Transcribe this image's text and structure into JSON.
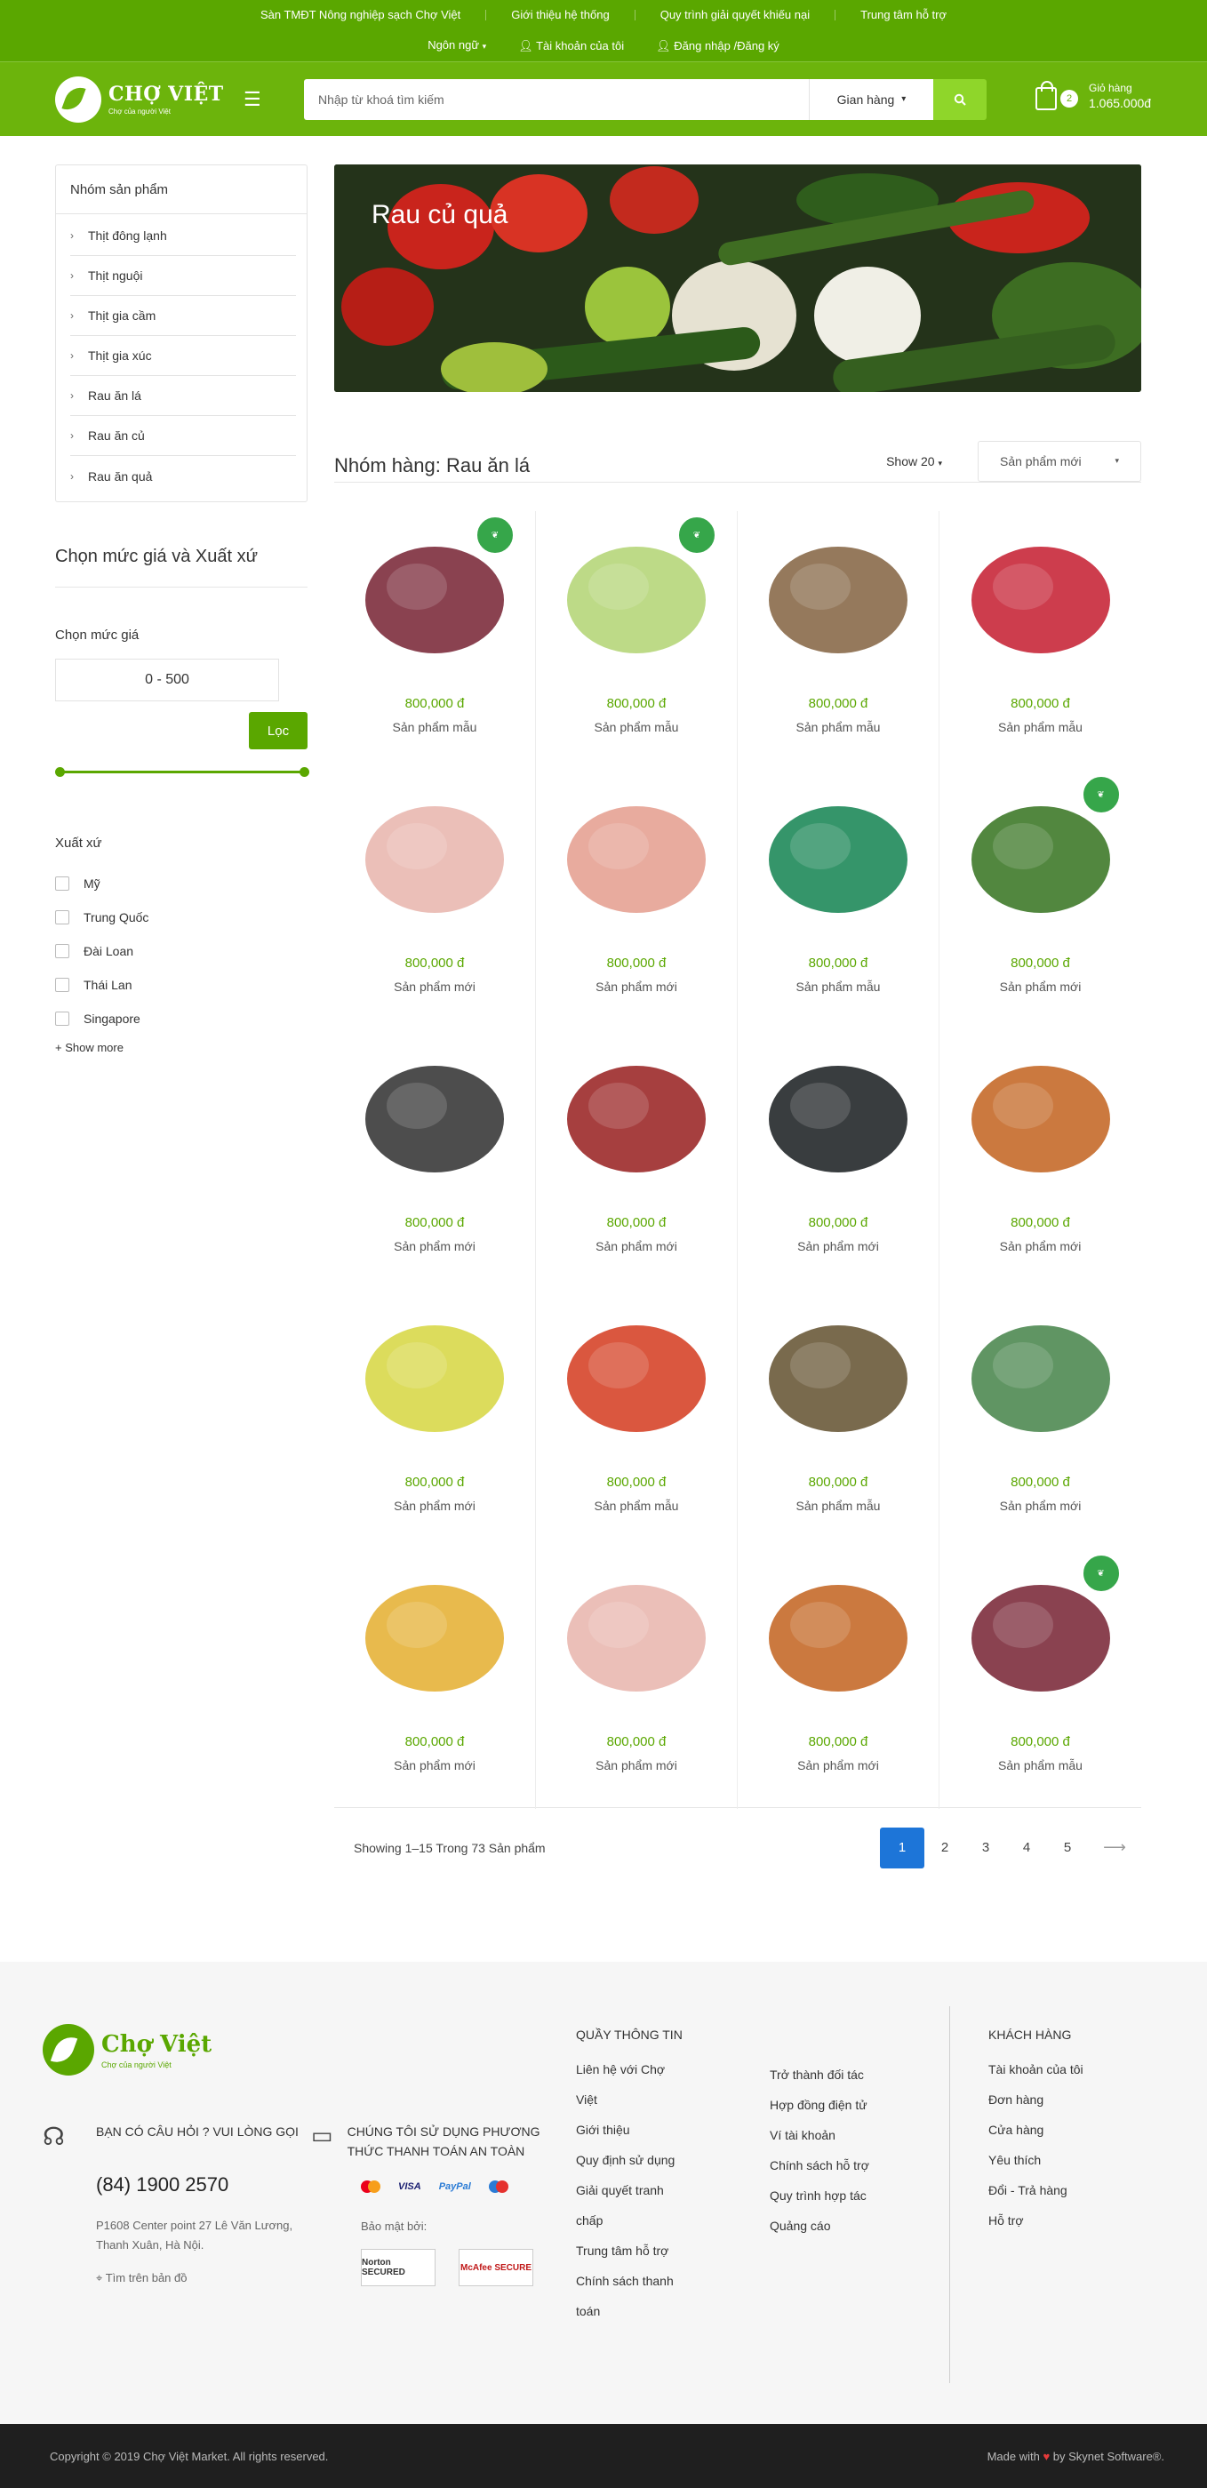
{
  "topbar": {
    "links": [
      "Sàn TMĐT Nông nghiệp sạch Chợ Việt",
      "Giới thiệu hệ thống",
      "Quy trình giải quyết khiếu nại",
      "Trung tâm hỗ trợ"
    ],
    "language": "Ngôn ngữ",
    "account": "Tài khoản của tôi",
    "login": "Đăng nhập /Đăng ký"
  },
  "header": {
    "logo_name": "CHỢ VIỆT",
    "logo_tagline": "Chợ của người Việt",
    "search_placeholder": "Nhập từ khoá tìm kiếm",
    "store_select": "Gian hàng",
    "cart_count": "2",
    "cart_label": "Giỏ hàng",
    "cart_amount": "1.065.000đ"
  },
  "sidebar": {
    "categories_title": "Nhóm sản phẩm",
    "categories": [
      "Thịt đông lạnh",
      "Thịt nguội",
      "Thịt gia cầm",
      "Thịt gia xúc",
      "Rau ăn lá",
      "Rau ăn củ",
      "Rau ăn quả"
    ],
    "filter_title": "Chọn mức giá và Xuất xứ",
    "price_label": "Chọn mức giá",
    "price_range": "0 - 500",
    "filter_button": "Lọc",
    "price_slider": {
      "min": 0,
      "max": 500
    },
    "origin_title": "Xuất xứ",
    "origins": [
      "Mỹ",
      "Trung Quốc",
      "Đài Loan",
      "Thái Lan",
      "Singapore"
    ],
    "show_more": "+ Show more"
  },
  "main": {
    "banner_title": "Rau củ quả",
    "group_title": "Nhóm hàng: Rau ăn lá",
    "show_count": "Show 20",
    "sort": "Sản phẩm mới",
    "products": [
      {
        "price": "800,000 đ",
        "name": "Sản phẩm mẫu",
        "badge": true,
        "color": "#7d2d3d"
      },
      {
        "price": "800,000 đ",
        "name": "Sản phẩm mẫu",
        "badge": true,
        "color": "#b6d67a"
      },
      {
        "price": "800,000 đ",
        "name": "Sản phẩm mẫu",
        "badge": false,
        "color": "#8a6a4a"
      },
      {
        "price": "800,000 đ",
        "name": "Sản phẩm mẫu",
        "badge": false,
        "color": "#c8283a"
      },
      {
        "price": "800,000 đ",
        "name": "Sản phẩm mới",
        "badge": false,
        "color": "#e9b8b0"
      },
      {
        "price": "800,000 đ",
        "name": "Sản phẩm mới",
        "badge": false,
        "color": "#e5a294"
      },
      {
        "price": "800,000 đ",
        "name": "Sản phẩm mẫu",
        "badge": false,
        "color": "#1f8a5a"
      },
      {
        "price": "800,000 đ",
        "name": "Sản phẩm mới",
        "badge": true,
        "color": "#3f7a2a"
      },
      {
        "price": "800,000 đ",
        "name": "Sản phẩm mới",
        "badge": false,
        "color": "#3a3a3a"
      },
      {
        "price": "800,000 đ",
        "name": "Sản phẩm mới",
        "badge": false,
        "color": "#9c2a2a"
      },
      {
        "price": "800,000 đ",
        "name": "Sản phẩm mới",
        "badge": false,
        "color": "#23282a"
      },
      {
        "price": "800,000 đ",
        "name": "Sản phẩm mới",
        "badge": false,
        "color": "#c56a2a"
      },
      {
        "price": "800,000 đ",
        "name": "Sản phẩm mới",
        "badge": false,
        "color": "#d8d84a"
      },
      {
        "price": "800,000 đ",
        "name": "Sản phẩm mẫu",
        "badge": false,
        "color": "#d6452a"
      },
      {
        "price": "800,000 đ",
        "name": "Sản phẩm mẫu",
        "badge": false,
        "color": "#6a5a3a"
      },
      {
        "price": "800,000 đ",
        "name": "Sản phẩm mới",
        "badge": false,
        "color": "#4f8a52"
      },
      {
        "price": "800,000 đ",
        "name": "Sản phẩm mới",
        "badge": false,
        "color": "#e5b23a"
      },
      {
        "price": "800,000 đ",
        "name": "Sản phẩm mới",
        "badge": false,
        "color": "#e9b8b0"
      },
      {
        "price": "800,000 đ",
        "name": "Sản phẩm mới",
        "badge": false,
        "color": "#c56a2a"
      },
      {
        "price": "800,000 đ",
        "name": "Sản phẩm mẫu",
        "badge": true,
        "color": "#7d2d3d"
      }
    ],
    "pager_text": "Showing 1–15 Trong 73 Sản phẩm",
    "pages": [
      "1",
      "2",
      "3",
      "4",
      "5"
    ],
    "next_arrow": "⟶"
  },
  "footer": {
    "logo_name": "Chợ Việt",
    "logo_tagline": "Chợ của người Việt",
    "question": "BẠN CÓ CÂU HỎI ? VUI LÒNG GỌI",
    "phone": "(84) 1900 2570",
    "address": "P1608 Center point 27 Lê Văn Lương, Thanh Xuân, Hà Nội.",
    "map_link": "Tìm trên bản đồ",
    "payment_title": "CHÚNG TÔI SỬ DỤNG PHƯƠNG THỨC THANH TOÁN AN TOÀN",
    "cards": [
      "VISA",
      "PayPal"
    ],
    "security_label": "Bảo mật bởi:",
    "seals": [
      "Norton SECURED",
      "McAfee SECURE"
    ],
    "info_title": "QUẦY THÔNG TIN",
    "info_links_col1": [
      "Liên hệ với Chợ Việt",
      "Giới thiệu",
      "Quy định sử dụng",
      "Giải quyết tranh chấp",
      "Trung tâm hỗ trợ",
      "Chính sách thanh toán"
    ],
    "info_links_col2": [
      "Trở thành đối tác",
      "Hợp đồng điện tử",
      "Ví tài khoản",
      "Chính sách hỗ trợ",
      "Quy trình hợp tác",
      "Quảng cáo"
    ],
    "customer_title": "KHÁCH HÀNG",
    "customer_links": [
      "Tài khoản của tôi",
      "Đơn hàng",
      "Cửa hàng",
      "Yêu thích",
      "Đổi - Trả hàng",
      "Hỗ trợ"
    ],
    "copyright": "Copyright © 2019 Chợ Việt Market. All rights reserved.",
    "made_with_prefix": "Made with",
    "made_with_suffix": "by Skynet Software®."
  }
}
